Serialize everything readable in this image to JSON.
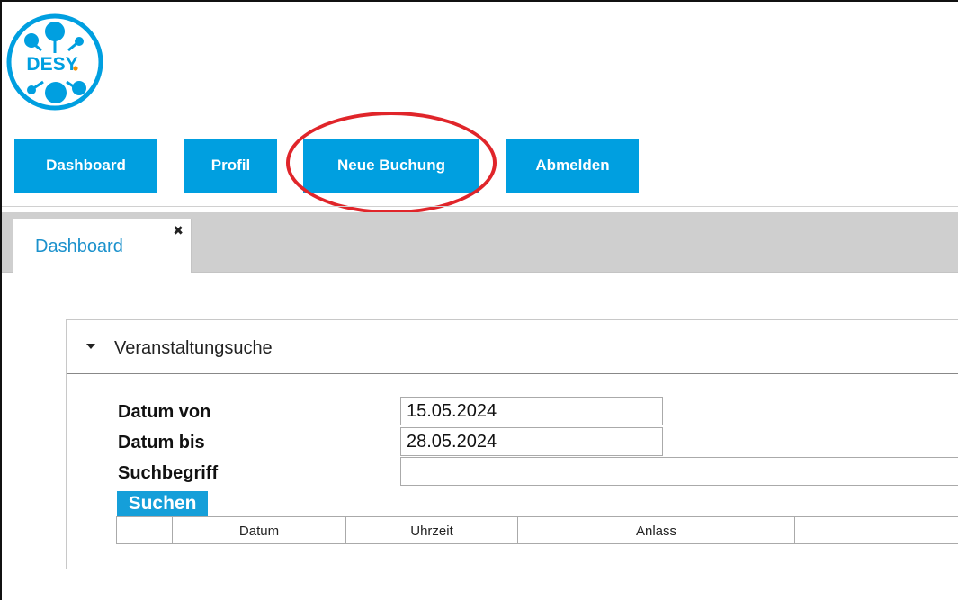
{
  "logo": {
    "text": "DESY.",
    "brand_color": "#009fe0",
    "dot_color": "#f08c00",
    "icon": "desy-logo-icon"
  },
  "nav": {
    "dashboard": "Dashboard",
    "profil": "Profil",
    "neue_buchung": "Neue Buchung",
    "abmelden": "Abmelden",
    "button_color": "#009fe0",
    "highlight_color": "#e0252a"
  },
  "tabs": [
    {
      "label": "Dashboard",
      "close_icon": "close-icon",
      "close_symbol": "✖"
    }
  ],
  "panel": {
    "title": "Veranstaltungsuche",
    "caret_icon": "caret-down-icon",
    "fields": {
      "datum_von": {
        "label": "Datum von",
        "value": "15.05.2024"
      },
      "datum_bis": {
        "label": "Datum bis",
        "value": "28.05.2024"
      },
      "suchbegriff": {
        "label": "Suchbegriff",
        "value": ""
      }
    },
    "search_button": "Suchen",
    "table": {
      "headers": [
        "",
        "Datum",
        "Uhrzeit",
        "Anlass",
        ""
      ],
      "rows": []
    }
  }
}
